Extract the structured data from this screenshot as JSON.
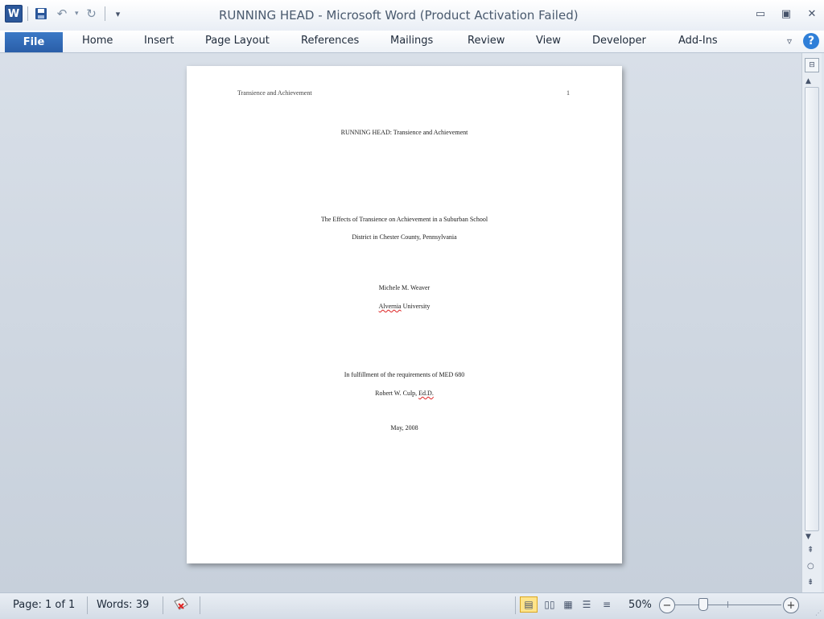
{
  "window": {
    "title": "RUNNING HEAD  -  Microsoft Word (Product Activation Failed)",
    "app_icon": "W",
    "controls": [
      "minimize-icon",
      "restore-icon",
      "close-icon"
    ]
  },
  "ribbon": {
    "file_label": "File",
    "tabs": [
      "Home",
      "Insert",
      "Page Layout",
      "References",
      "Mailings",
      "Review",
      "View",
      "Developer",
      "Add-Ins"
    ],
    "help": "?"
  },
  "document": {
    "header_left": "Transience and Achievement",
    "header_right": "1",
    "running_head": "RUNNING HEAD: Transience and Achievement",
    "title_line1": "The Effects of Transience on Achievement in a Suburban School",
    "title_line2": "District in Chester County, Pennsylvania",
    "author": "Michele M. Weaver",
    "institution_word": "Alvernia",
    "institution_rest": " University",
    "fulfillment": "In fulfillment of the requirements of MED 680",
    "advisor_prefix": "Robert W. Culp, ",
    "advisor_degree": "Ed.D.",
    "date": "May, 2008"
  },
  "status": {
    "page": "Page: 1 of 1",
    "words": "Words: 39",
    "zoom": "50%",
    "zoom_level": 50,
    "active_view": "print-layout"
  }
}
